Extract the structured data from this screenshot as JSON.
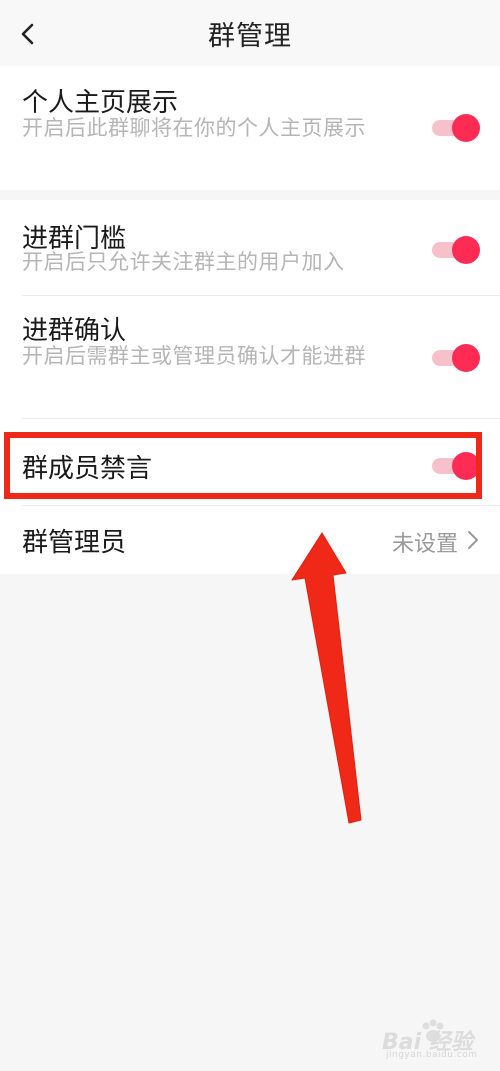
{
  "nav": {
    "title": "群管理"
  },
  "settings": [
    {
      "title": "个人主页展示",
      "description": "开启后此群聊将在你的个人主页展示",
      "enabled": true
    },
    {
      "title": "进群门槛",
      "description": "开启后只允许关注群主的用户加入",
      "enabled": true
    },
    {
      "title": "进群确认",
      "description": "开启后需群主或管理员确认才能进群",
      "enabled": true
    },
    {
      "title": "群成员禁言",
      "enabled": true
    }
  ],
  "admin": {
    "label": "群管理员",
    "value": "未设置"
  },
  "icons": {
    "back": "chevron-left-icon",
    "row_arrow": "chevron-right-icon"
  },
  "colors": {
    "accent": "#fe2c55",
    "toggle_track": "#f7c1cb",
    "annotation": "#f02818"
  },
  "watermark": {
    "brand": "Bai 经验",
    "url": "jingyan.baidu.com"
  }
}
